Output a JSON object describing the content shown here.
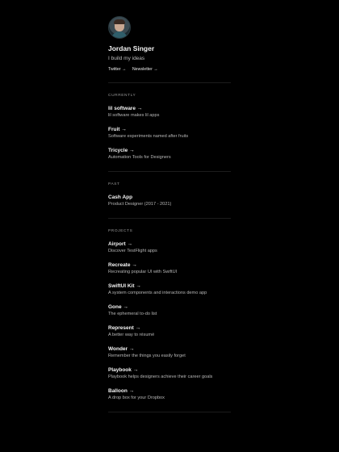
{
  "profile": {
    "name": "Jordan Singer",
    "tagline": "I build my ideas",
    "links": [
      {
        "label": "Twitter →"
      },
      {
        "label": "Newsletter →"
      }
    ]
  },
  "sections": {
    "currently": {
      "label": "CURRENTLY",
      "items": [
        {
          "title": "lil software →",
          "desc": "lil software makes lil apps"
        },
        {
          "title": "Fruit →",
          "desc": "Software experiments named after fruits"
        },
        {
          "title": "Tricycle →",
          "desc": "Automation Tools for Designers"
        }
      ]
    },
    "past": {
      "label": "PAST",
      "items": [
        {
          "title": "Cash App",
          "desc": "Product Designer (2017 - 2021)"
        }
      ]
    },
    "projects": {
      "label": "PROJECTS",
      "items": [
        {
          "title": "Airport →",
          "desc": "Discover TestFlight apps"
        },
        {
          "title": "Recreate →",
          "desc": "Recreating popular UI with SwiftUI"
        },
        {
          "title": "SwiftUI Kit →",
          "desc": "A system components and interactions demo app"
        },
        {
          "title": "Gone →",
          "desc": "The ephemeral to-do list"
        },
        {
          "title": "Represent →",
          "desc": "A better way to résumé"
        },
        {
          "title": "Wonder →",
          "desc": "Remember the things you easily forget"
        },
        {
          "title": "Playbook →",
          "desc": "Playbook helps designers achieve their career goals"
        },
        {
          "title": "Balloon →",
          "desc": "A drop box for your Dropbox"
        }
      ]
    }
  }
}
